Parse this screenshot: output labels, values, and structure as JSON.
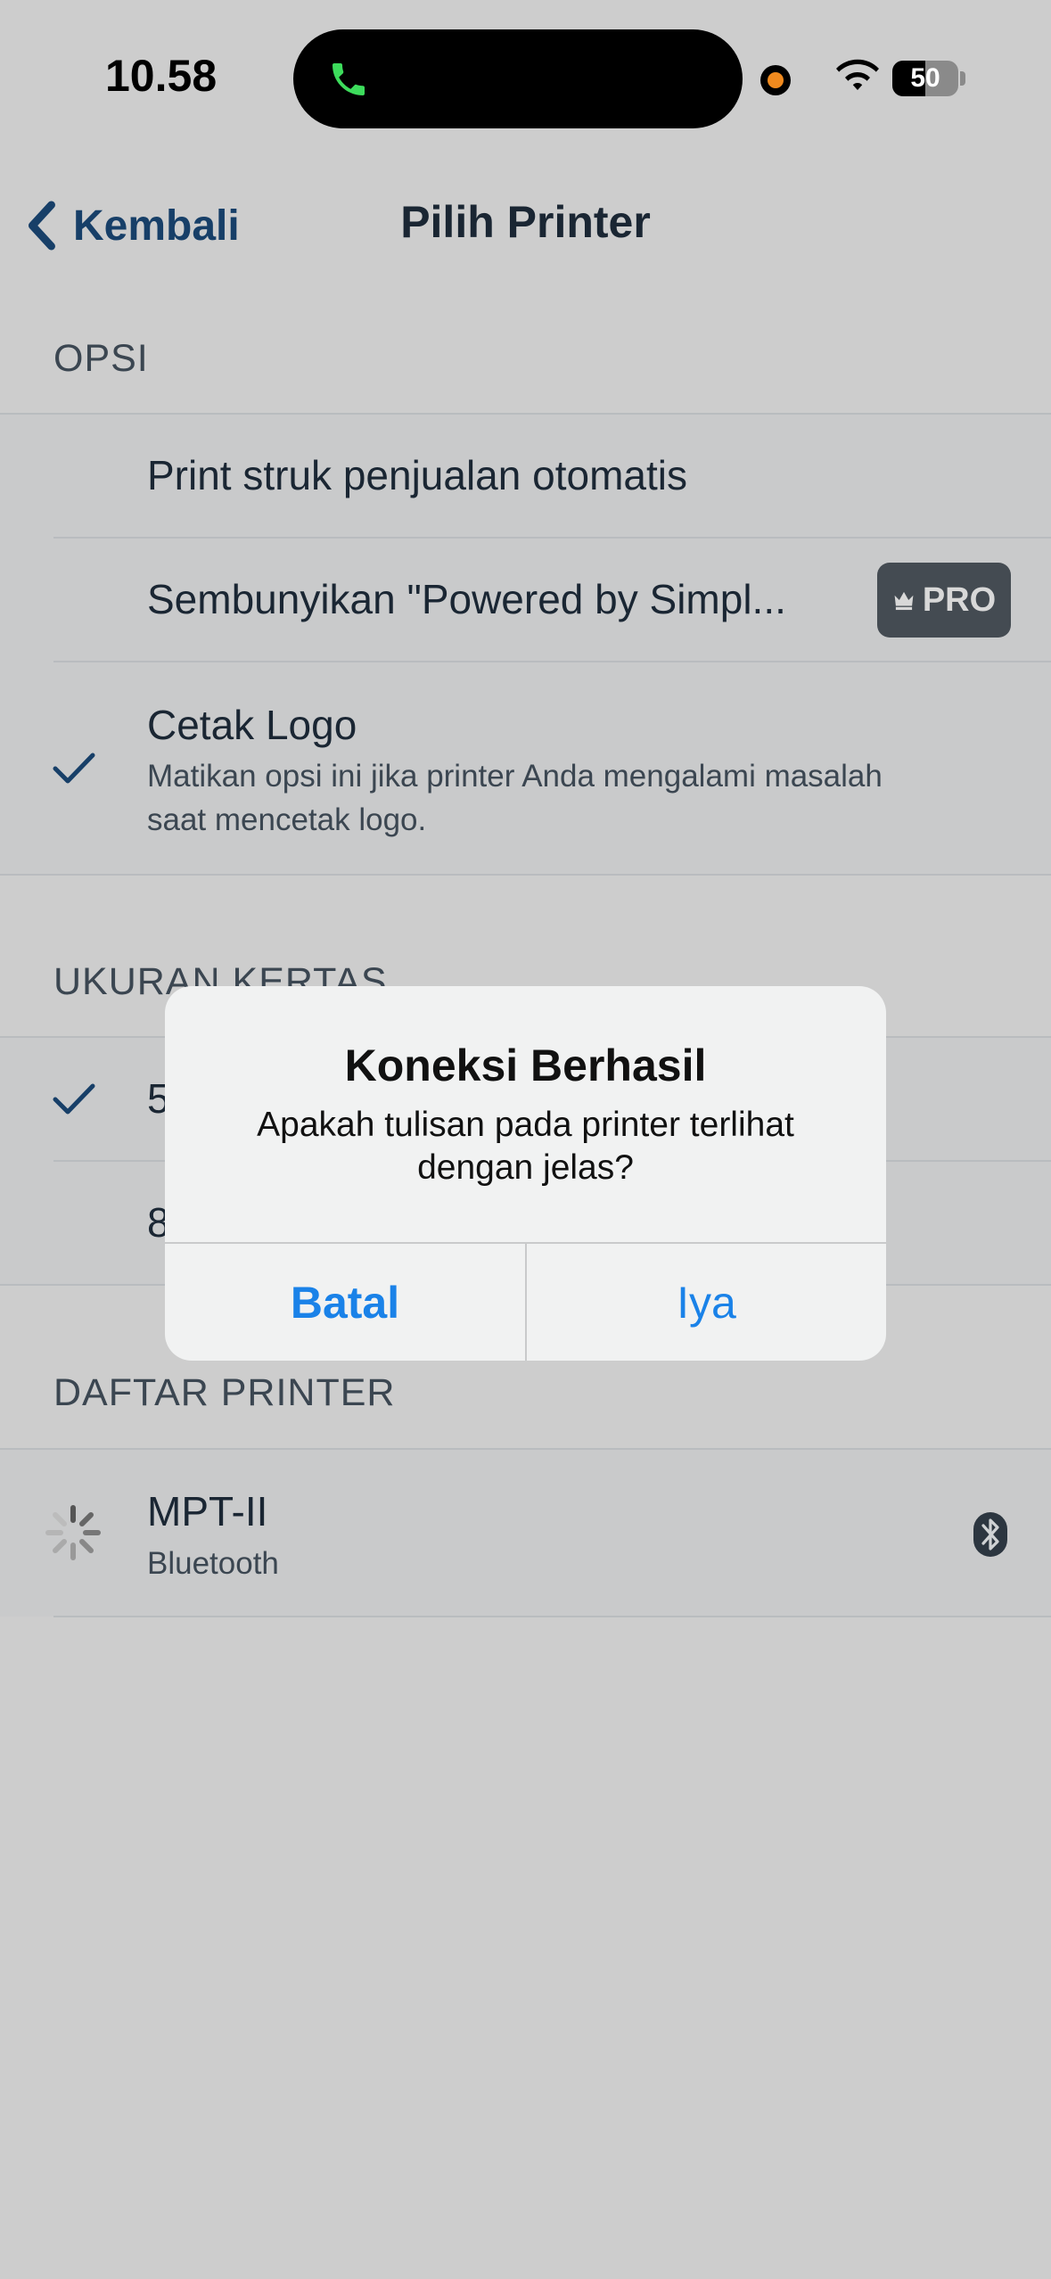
{
  "status_bar": {
    "time": "10.58",
    "battery_level": "50",
    "battery_fraction": 0.5,
    "call_icon": "phone-icon",
    "call_color": "#3ddc5c",
    "indicator_color": "#f08a1e"
  },
  "nav": {
    "back_label": "Kembali",
    "title": "Pilih Printer"
  },
  "options": {
    "header": "OPSI",
    "items": [
      {
        "title": "Print struk penjualan otomatis",
        "checked": false
      },
      {
        "title": "Sembunyikan \"Powered by Simpl...",
        "badge": "PRO",
        "badge_icon": "crown-icon",
        "checked": false
      },
      {
        "title": "Cetak Logo",
        "subtitle": "Matikan opsi ini jika printer Anda mengalami masalah saat mencetak logo.",
        "checked": true
      }
    ]
  },
  "paper_size": {
    "header": "UKURAN KERTAS",
    "items": [
      {
        "title": "5",
        "checked": true
      },
      {
        "title": "8",
        "checked": false
      }
    ]
  },
  "printers": {
    "header": "DAFTAR PRINTER",
    "items": [
      {
        "name": "MPT-II",
        "type": "Bluetooth",
        "status_icon": "spinner-icon",
        "trailing_icon": "bluetooth-icon"
      }
    ]
  },
  "alert": {
    "title": "Koneksi Berhasil",
    "message": "Apakah tulisan pada printer terlihat dengan jelas?",
    "cancel_label": "Batal",
    "ok_label": "Iya"
  },
  "colors": {
    "accent": "#173f68",
    "alert_button": "#1a82e8"
  }
}
